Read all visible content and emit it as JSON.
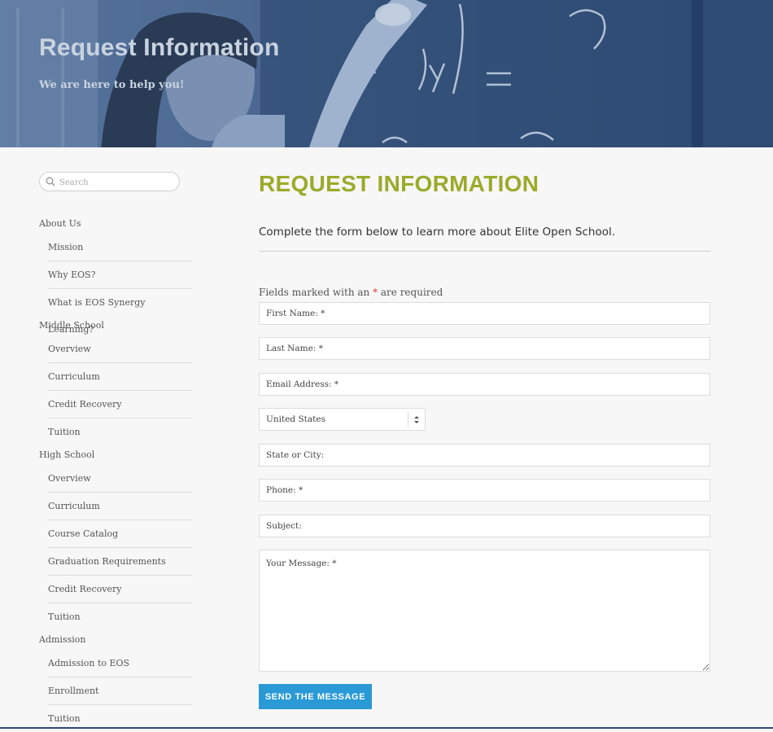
{
  "hero": {
    "title": "Request Information",
    "subtitle": "We are here to help you!",
    "image": "student-at-chalkboard-photo"
  },
  "sidebar": {
    "search": {
      "placeholder": "Search",
      "icon": "search-icon"
    },
    "groups": [
      {
        "title": "About Us",
        "items": [
          "Mission",
          "Why EOS?",
          "What is EOS Synergy Learning?"
        ]
      },
      {
        "title": "Middle School",
        "items": [
          "Overview",
          "Curriculum",
          "Credit Recovery",
          "Tuition"
        ]
      },
      {
        "title": "High School",
        "items": [
          "Overview",
          "Curriculum",
          "Course Catalog",
          "Graduation Requirements",
          "Credit Recovery",
          "Tuition"
        ]
      },
      {
        "title": "Admission",
        "items": [
          "Admission to EOS",
          "Enrollment",
          "Tuition"
        ]
      }
    ]
  },
  "main": {
    "title": "REQUEST INFORMATION",
    "intro": "Complete the form below to learn more about Elite Open School.",
    "required_note": {
      "prefix": "Fields marked with an ",
      "star": "*",
      "suffix": " are required"
    },
    "fields": {
      "first_name": "First Name: *",
      "last_name": "Last Name: *",
      "email": "Email Address: *",
      "country": "United States",
      "state_city": "State or City:",
      "phone": "Phone: *",
      "subject": "Subject:",
      "message": "Your Message: *"
    },
    "submit_label": "SEND THE MESSAGE"
  },
  "colors": {
    "title_green": "#9aab2a",
    "button_blue": "#2a9ad6",
    "required_red": "#e0443a",
    "hero_blue": "#3d5a83"
  }
}
